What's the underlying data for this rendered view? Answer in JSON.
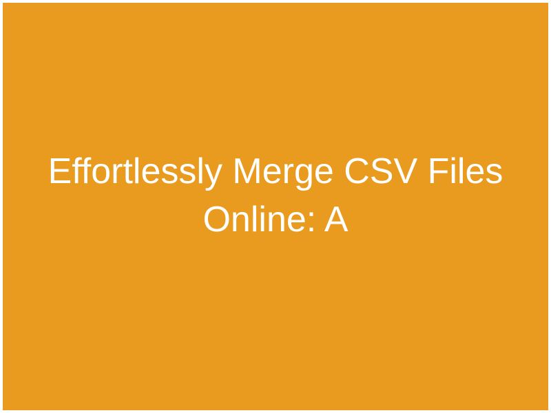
{
  "banner": {
    "title": "Effortlessly Merge CSV Files Online: A"
  }
}
